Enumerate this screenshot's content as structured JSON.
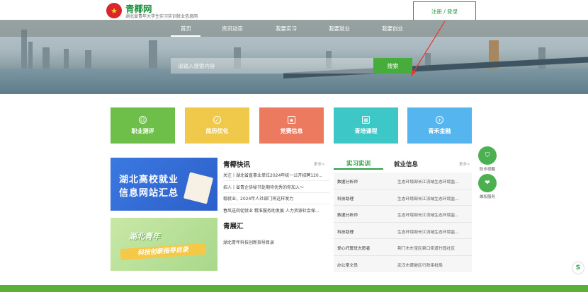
{
  "header": {
    "logo_glyph": "★",
    "site_title": "青椰网",
    "site_subtitle": "湖北省青年大学生实习实训就业信息网",
    "login_label": "注册 / 登录"
  },
  "nav": {
    "items": [
      {
        "label": "首页"
      },
      {
        "label": "资讯动态"
      },
      {
        "label": "我要实习"
      },
      {
        "label": "我要就业"
      },
      {
        "label": "我要创业"
      }
    ]
  },
  "search": {
    "placeholder": "请输入搜索内容",
    "button_label": "搜索"
  },
  "tiles": [
    {
      "label": "职业测评",
      "color": "#6ebf4a",
      "icon": "smile-icon"
    },
    {
      "label": "简历优化",
      "color": "#f1c94a",
      "icon": "badge-icon"
    },
    {
      "label": "竞赛信息",
      "color": "#ec7a5e",
      "icon": "briefcase-icon"
    },
    {
      "label": "青培课程",
      "color": "#3ec7c7",
      "icon": "calendar-icon"
    },
    {
      "label": "青禾金融",
      "color": "#55b6ef",
      "icon": "plus-icon"
    }
  ],
  "promo": {
    "banner1_line1": "湖北高校就业",
    "banner1_line2": "信息网站汇总",
    "banner2_line1": "湖北青年",
    "banner2_line2": "科技创新指导目录"
  },
  "news": {
    "title": "青椰快讯",
    "more": "更多>",
    "items": [
      "关注丨湖北省直事业单位2024年统一公开招聘120...",
      "招人丨省青企协秘书处期待优秀的你加入～",
      "稳就业，2024年人社部门将这样发力",
      "春风送岗促就业 精准服务助发展 人力资源社会保..."
    ]
  },
  "exhibit": {
    "title": "青展汇",
    "items": [
      "湖北青年科技创新指导目录"
    ]
  },
  "jobs": {
    "tab_intern": "实习实训",
    "tab_jobs": "就业信息",
    "more": "更多>",
    "rows": [
      {
        "name": "数据分析师",
        "company": "生态环境部长江流域生态环境监..."
      },
      {
        "name": "科技助理",
        "company": "生态环境部长江流域生态环境监..."
      },
      {
        "name": "数据分析师",
        "company": "生态环境部长江流域生态环境监..."
      },
      {
        "name": "科技助理",
        "company": "生态环境部长江流域生态环境监..."
      },
      {
        "name": "爱心托管班志愿者",
        "company": "荆门市东宝区泉口街道竹园社区"
      },
      {
        "name": "办公室文员",
        "company": "武汉市黄陂区行政审批局"
      }
    ]
  },
  "float": {
    "btn1_label": "防诈提醒",
    "btn2_label": "维权服务"
  },
  "colors": {
    "brand_green": "#2e9d47",
    "annotation_red": "#e53935"
  }
}
